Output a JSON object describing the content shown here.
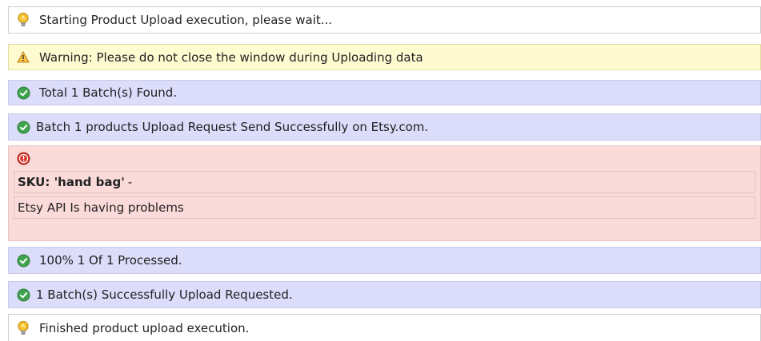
{
  "log": {
    "rows": [
      {
        "type": "info",
        "icon": "lightbulb-icon",
        "text": "Starting Product Upload execution, please wait..."
      },
      {
        "type": "warn",
        "icon": "warning-icon",
        "text": "Warning: Please do not close the window during Uploading data"
      },
      {
        "type": "ok",
        "icon": "check-circle-icon",
        "text": "Total 1 Batch(s) Found."
      },
      {
        "type": "ok",
        "icon": "check-circle-icon",
        "text": "Batch 1 products Upload Request Send Successfully on Etsy.com."
      },
      {
        "type": "error",
        "icon": "error-circle-icon",
        "sku_label": "SKU: 'hand bag'",
        "sku_suffix": "-",
        "message": "Etsy API Is having problems"
      },
      {
        "type": "ok",
        "icon": "check-circle-icon",
        "text": "100% 1 Of 1 Processed."
      },
      {
        "type": "ok",
        "icon": "check-circle-icon",
        "text": "1 Batch(s) Successfully Upload Requested."
      },
      {
        "type": "info",
        "icon": "lightbulb-icon",
        "text": "Finished product upload execution."
      }
    ]
  },
  "colors": {
    "ok_background": "#dcdcfb",
    "warn_background": "#fefbd1",
    "error_background": "#fbdada",
    "check_green": "#3fa34d",
    "error_red": "#d9362b",
    "bulb_yellow": "#f6c330"
  }
}
